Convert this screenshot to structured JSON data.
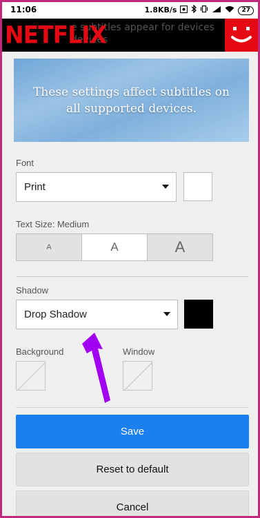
{
  "status_bar": {
    "time": "11:06",
    "network_speed": "1.8KB/s",
    "battery": "27",
    "icons": [
      "screen-record-icon",
      "bluetooth-icon",
      "vibrate-icon",
      "signal-icon",
      "wifi-icon",
      "battery-icon"
    ]
  },
  "header": {
    "logo": "NETFLIX",
    "ghost_text_line1": "e subtitles appear for devices",
    "ghost_text_line2": "devices",
    "brand_color": "#e50914"
  },
  "banner": {
    "text": "These settings affect subtitles on all supported devices."
  },
  "font": {
    "label": "Font",
    "value": "Print",
    "color_swatch": "#ffffff"
  },
  "text_size": {
    "label": "Text Size: Medium",
    "options": [
      "A",
      "A",
      "A"
    ],
    "selected_index": 1
  },
  "shadow": {
    "label": "Shadow",
    "value": "Drop Shadow",
    "color_swatch": "#000000"
  },
  "background": {
    "label": "Background"
  },
  "window": {
    "label": "Window"
  },
  "buttons": {
    "save": "Save",
    "reset": "Reset to default",
    "cancel": "Cancel"
  },
  "colors": {
    "accent": "#1b7ff0",
    "annotation_arrow": "#a100f2",
    "frame_border": "#c02a7d"
  }
}
